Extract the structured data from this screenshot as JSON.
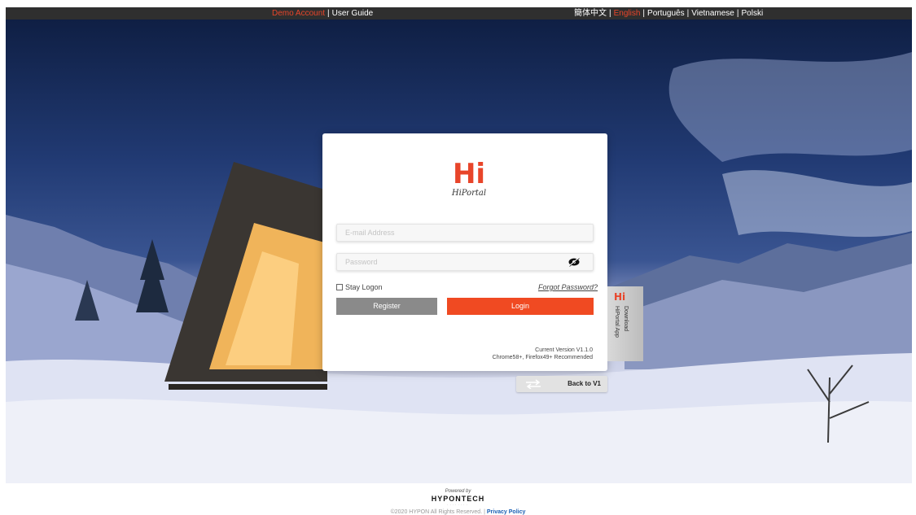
{
  "topbar": {
    "left_links": [
      {
        "label": "Demo Account",
        "active": true
      },
      {
        "label": "User Guide",
        "active": false
      }
    ],
    "languages": [
      {
        "label": "簡体中文",
        "active": false
      },
      {
        "label": "English",
        "active": true
      },
      {
        "label": "Português",
        "active": false
      },
      {
        "label": "Vietnamese",
        "active": false
      },
      {
        "label": "Polski",
        "active": false
      }
    ],
    "separator": "|"
  },
  "login": {
    "logo_mark": "Hi",
    "logo_name": "HiPortal",
    "email_placeholder": "E-mail Address",
    "password_placeholder": "Password",
    "stay_logon_label": "Stay Logon",
    "forgot_password_label": "Forgot Password?",
    "register_label": "Register",
    "login_label": "Login",
    "version_text": "Current Version V1.1.0",
    "browser_text": "Chrome58+, Firefox49+ Recommended"
  },
  "app_tab": {
    "logo_mark": "Hi",
    "line1": "Download",
    "line2": "HiPortal App"
  },
  "back_button": {
    "label": "Back to V1"
  },
  "footer": {
    "powered_by": "Powered by",
    "brand": "HYPONTECH",
    "copyright": "©2020 HYPON All Rights Reserved.",
    "separator": "|",
    "privacy": "Privacy Policy"
  },
  "colors": {
    "accent": "#e8452a",
    "login_button": "#f04a22",
    "register_button": "#8a8a8a",
    "topbar": "#2f2f2f"
  }
}
